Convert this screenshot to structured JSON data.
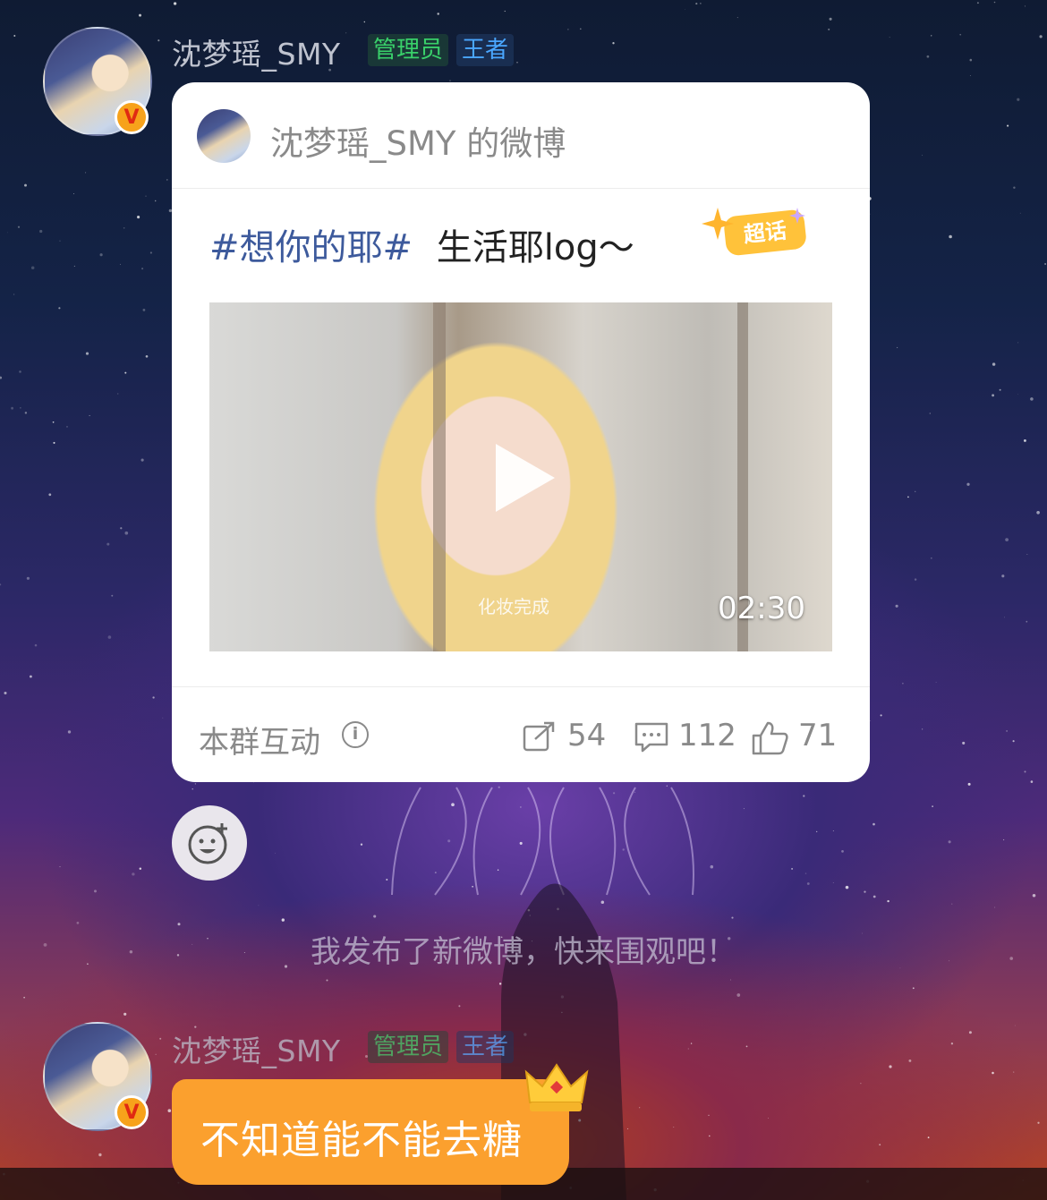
{
  "messages": [
    {
      "sender": "沈梦瑶_SMY",
      "tags": {
        "admin": "管理员",
        "level": "王者"
      },
      "verified_badge": "V",
      "weibo_card": {
        "title": "沈梦瑶_SMY 的微博",
        "hashtag": "#想你的耶#",
        "text": "生活耶log～",
        "topic_badge": "超话",
        "video": {
          "duration": "02:30",
          "watermark": "化妆完成"
        },
        "footer": {
          "label": "本群互动",
          "reposts": "54",
          "comments": "112",
          "likes": "71"
        }
      }
    }
  ],
  "system_message": "我发布了新微博，快来围观吧！",
  "second_message": {
    "sender": "沈梦瑶_SMY",
    "tags": {
      "admin": "管理员",
      "level": "王者"
    },
    "verified_badge": "V",
    "text": "不知道能不能去糖"
  },
  "colors": {
    "bubble": "#fba02e",
    "admin_tag": "#39d06a",
    "level_tag": "#4aa7ff",
    "hashtag": "#3d5a9c",
    "verified": "#f7a21b"
  },
  "icons": [
    "verified-v-icon",
    "info-icon",
    "repost-icon",
    "comment-icon",
    "like-icon",
    "emoji-add-icon",
    "play-icon",
    "crown-icon",
    "chaohua-badge"
  ]
}
